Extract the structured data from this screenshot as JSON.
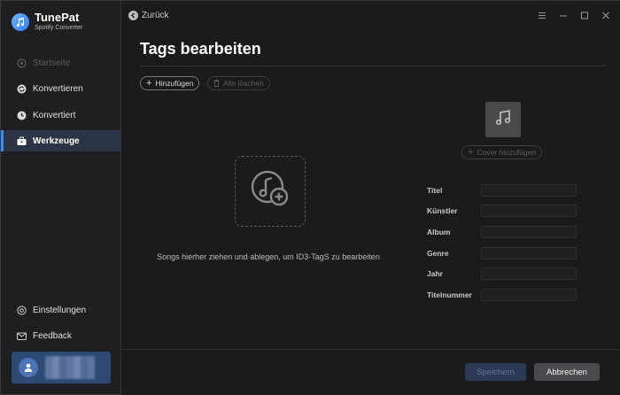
{
  "app": {
    "name": "TunePat",
    "subtitle": "Spotify Converter"
  },
  "sidebar": {
    "items": [
      {
        "label": "Startseite",
        "icon": "home-icon",
        "state": "disabled"
      },
      {
        "label": "Konvertieren",
        "icon": "convert-icon",
        "state": "normal"
      },
      {
        "label": "Konvertiert",
        "icon": "clock-icon",
        "state": "normal"
      },
      {
        "label": "Werkzeuge",
        "icon": "toolbox-icon",
        "state": "active"
      }
    ],
    "bottom_items": [
      {
        "label": "Einstellungen",
        "icon": "settings-icon"
      },
      {
        "label": "Feedback",
        "icon": "mail-icon"
      }
    ]
  },
  "topbar": {
    "back_label": "Zurück"
  },
  "page": {
    "title": "Tags bearbeiten",
    "add_label": "Hinzufügen",
    "clear_all_label": "Alle löschen",
    "drop_hint": "Songs hierher ziehen und ablegen, um ID3-TagS zu bearbeiten",
    "cover_add_label": "Cover hinzufügen"
  },
  "fields": [
    {
      "label": "Titel",
      "value": ""
    },
    {
      "label": "Künstler",
      "value": ""
    },
    {
      "label": "Album",
      "value": ""
    },
    {
      "label": "Genre",
      "value": ""
    },
    {
      "label": "Jahr",
      "value": ""
    },
    {
      "label": "Titelnummer",
      "value": ""
    }
  ],
  "actions": {
    "save_label": "Speichern",
    "cancel_label": "Abbrechen"
  },
  "colors": {
    "accent": "#3d8cff",
    "active_bg": "#2a3444",
    "background": "#1b1b1e"
  }
}
